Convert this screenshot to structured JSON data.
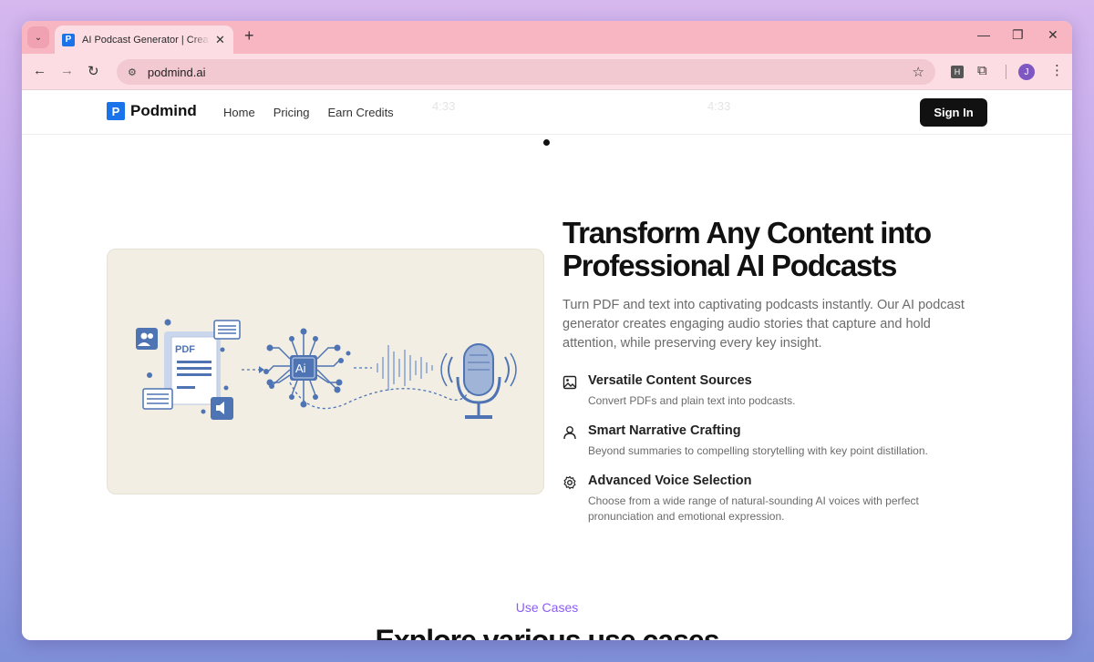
{
  "browser": {
    "tab_title": "AI Podcast Generator | Create Podcasts",
    "url": "podmind.ai",
    "favicon_letter": "P",
    "extension_letter": "H",
    "profile_initial": "J"
  },
  "site": {
    "brand": "Podmind",
    "logo_letter": "P",
    "nav": [
      "Home",
      "Pricing",
      "Earn Credits"
    ],
    "sign_in": "Sign In",
    "ghost_timer_1": "4:33",
    "ghost_timer_2": "4:33"
  },
  "hero": {
    "title": "Transform Any Content into Professional AI Podcasts",
    "subtitle": "Turn PDF and text into captivating podcasts instantly. Our AI podcast generator creates engaging audio stories that capture and hold attention, while preserving every key insight.",
    "illustration": {
      "doc_label": "PDF",
      "chip_label": "Ai"
    }
  },
  "features": [
    {
      "icon": "image-icon",
      "title": "Versatile Content Sources",
      "desc": "Convert PDFs and plain text into podcasts."
    },
    {
      "icon": "user-icon",
      "title": "Smart Narrative Crafting",
      "desc": "Beyond summaries to compelling storytelling with key point distillation."
    },
    {
      "icon": "gear-icon",
      "title": "Advanced Voice Selection",
      "desc": "Choose from a wide range of natural-sounding AI voices with perfect pronunciation and emotional expression."
    }
  ],
  "use_cases": {
    "label": "Use Cases",
    "title": "Explore various use cases"
  },
  "colors": {
    "accent_blue": "#1a73e8",
    "illustration_blue": "#4f74b3",
    "use_cases_purple": "#8b5cf6",
    "tab_strip_pink": "#f7b6c2"
  }
}
